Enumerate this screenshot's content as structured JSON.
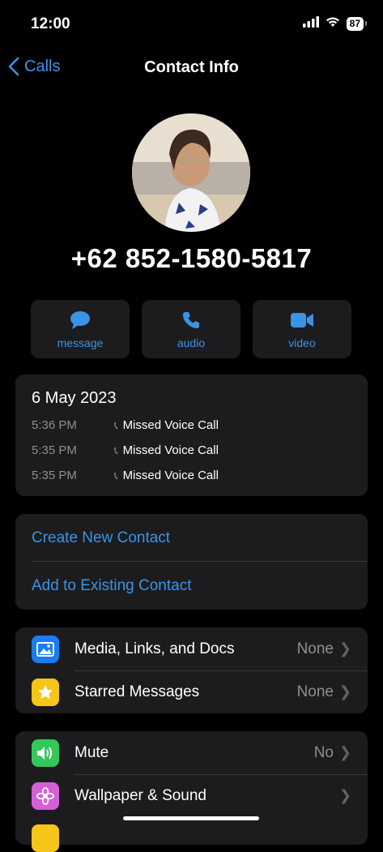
{
  "status": {
    "time": "12:00",
    "battery": "87"
  },
  "nav": {
    "back_label": "Calls",
    "title": "Contact Info"
  },
  "contact": {
    "phone": "+62 852-1580-5817"
  },
  "actions": [
    {
      "label": "message",
      "icon": "message-icon"
    },
    {
      "label": "audio",
      "icon": "phone-icon"
    },
    {
      "label": "video",
      "icon": "video-icon"
    }
  ],
  "call_log": {
    "date": "6 May 2023",
    "entries": [
      {
        "time": "5:36 PM",
        "type": "Missed Voice Call"
      },
      {
        "time": "5:35 PM",
        "type": "Missed Voice Call"
      },
      {
        "time": "5:35 PM",
        "type": "Missed Voice Call"
      }
    ]
  },
  "contact_actions": {
    "create": "Create New Contact",
    "add_existing": "Add to Existing Contact"
  },
  "media_section": [
    {
      "label": "Media, Links, and Docs",
      "value": "None",
      "icon": "photo-icon",
      "color": "#1a7cf5"
    },
    {
      "label": "Starred Messages",
      "value": "None",
      "icon": "star-icon",
      "color": "#f5c518"
    }
  ],
  "settings_section": [
    {
      "label": "Mute",
      "value": "No",
      "icon": "speaker-icon",
      "color": "#34c759"
    },
    {
      "label": "Wallpaper & Sound",
      "value": "",
      "icon": "flower-icon",
      "color": "#d65fd8"
    }
  ],
  "colors": {
    "accent": "#3b93e6",
    "card": "#1c1c1e"
  }
}
